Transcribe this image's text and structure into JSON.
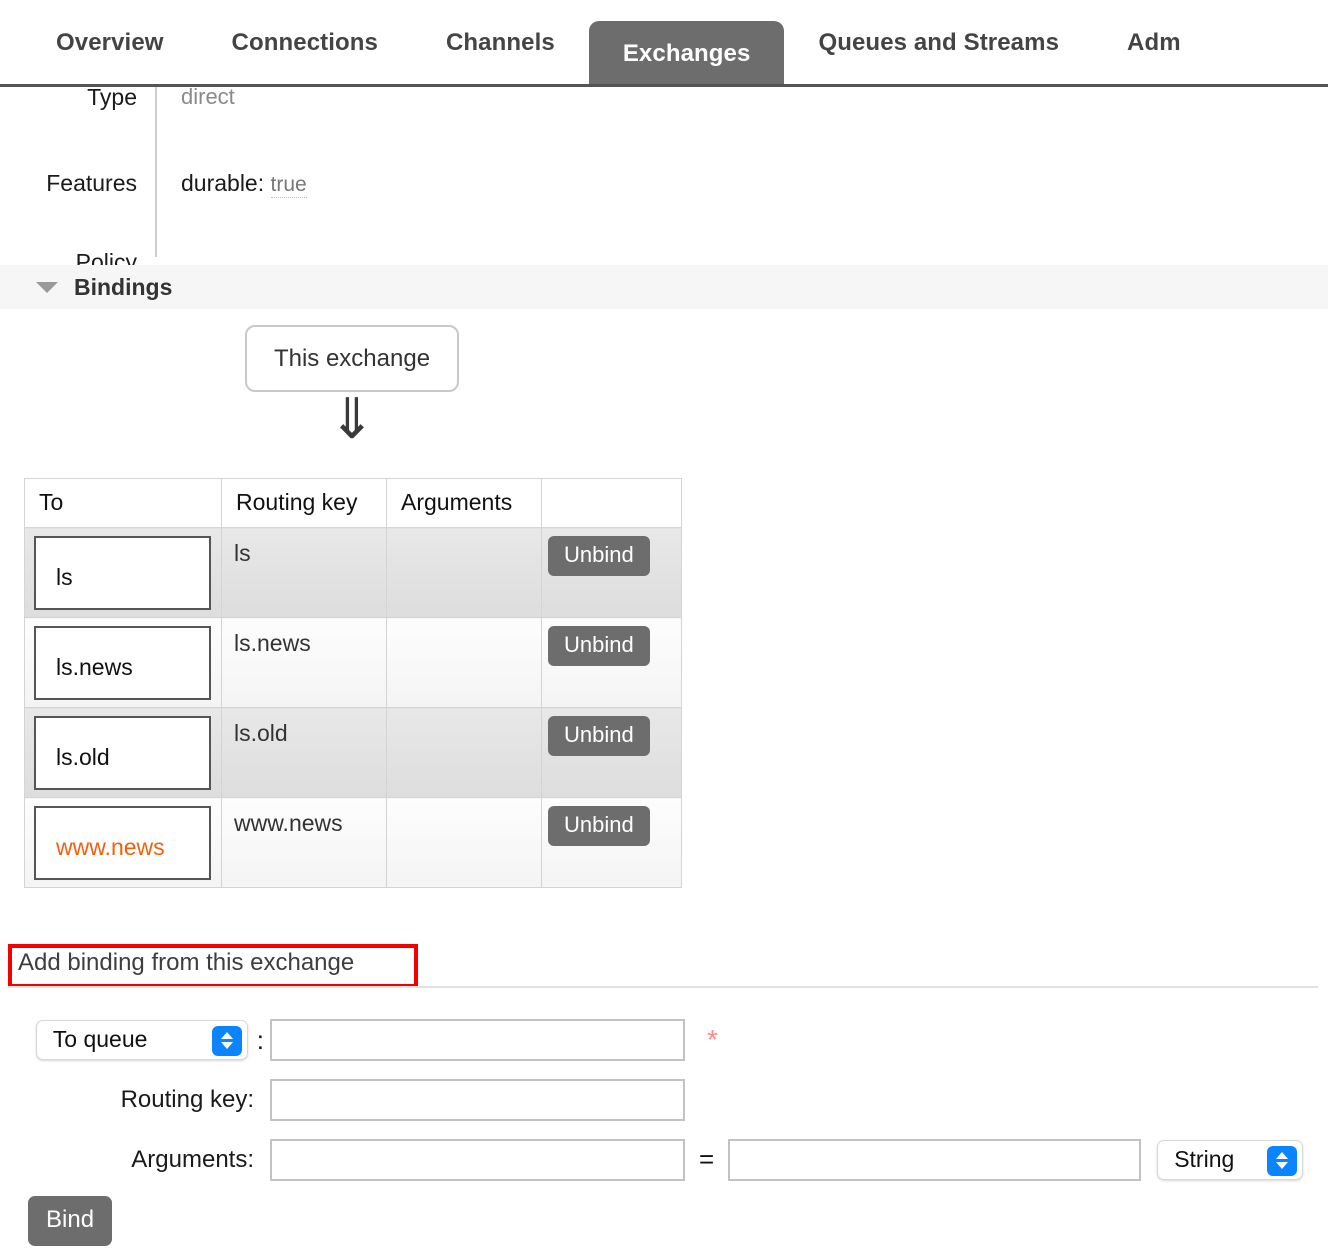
{
  "nav": {
    "tabs": [
      {
        "label": "Overview",
        "active": false
      },
      {
        "label": "Connections",
        "active": false
      },
      {
        "label": "Channels",
        "active": false
      },
      {
        "label": "Exchanges",
        "active": true
      },
      {
        "label": "Queues and Streams",
        "active": false
      },
      {
        "label": "Adm",
        "active": false
      }
    ]
  },
  "detail": {
    "type_label": "Type",
    "type_value": "direct",
    "features_label": "Features",
    "features_key": "durable:",
    "features_value": "true",
    "policy_label": "Policy",
    "policy_value": ""
  },
  "bindings_section": {
    "title": "Bindings",
    "collapse_icon": "triangle-down-icon",
    "exchange_node_label": "This exchange",
    "arrow_glyph": "⇓"
  },
  "bindings_table": {
    "columns": [
      "To",
      "Routing key",
      "Arguments",
      ""
    ],
    "rows": [
      {
        "to": "ls",
        "routing_key": "ls",
        "arguments": "",
        "action": "Unbind",
        "highlight": false
      },
      {
        "to": "ls.news",
        "routing_key": "ls.news",
        "arguments": "",
        "action": "Unbind",
        "highlight": false
      },
      {
        "to": "ls.old",
        "routing_key": "ls.old",
        "arguments": "",
        "action": "Unbind",
        "highlight": false
      },
      {
        "to": "www.news",
        "routing_key": "www.news",
        "arguments": "",
        "action": "Unbind",
        "highlight": true
      }
    ]
  },
  "add_binding_form": {
    "heading": "Add binding from this exchange",
    "destination_select": {
      "value": "To queue",
      "colon": ":"
    },
    "destination_input": {
      "value": "",
      "placeholder": ""
    },
    "required_marker": "*",
    "routing_key_label": "Routing key:",
    "routing_key_input": {
      "value": "",
      "placeholder": ""
    },
    "arguments_label": "Arguments:",
    "arguments_key_input": {
      "value": "",
      "placeholder": ""
    },
    "equals_sign": "=",
    "arguments_value_input": {
      "value": "",
      "placeholder": ""
    },
    "type_select": {
      "value": "String"
    },
    "submit_label": "Bind"
  },
  "colors": {
    "accent_orange": "#f2600c",
    "button_gray": "#6d6d6d",
    "highlight_red": "#f40000",
    "select_blue": "#0a84ff",
    "required_star": "#fd8a8a"
  }
}
